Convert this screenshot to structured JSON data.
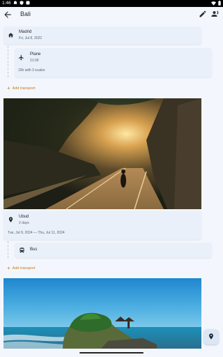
{
  "status_bar": {
    "time": "1:46",
    "icons": [
      "notification-icon",
      "shield-icon",
      "play-store-icon"
    ],
    "right_icons": [
      "wifi-icon",
      "battery-icon"
    ]
  },
  "app_bar": {
    "title": "Bali",
    "icons": [
      "back-arrow-icon",
      "edit-icon",
      "people-icon"
    ]
  },
  "itinerary": {
    "start": {
      "place": "Madrid",
      "date": "Fri, Jul 8, 2022"
    },
    "transport1": {
      "mode": "Plane",
      "time": "21:00",
      "note": "19h with 3 scales"
    },
    "add_transport_label": "Add transport",
    "stop1": {
      "place": "Ubud",
      "duration": "2 days",
      "dates": "Tue, Jul 9, 2024 — Thu, Jul 11, 2024"
    },
    "transport2": {
      "mode": "Bus"
    },
    "add_transport_label_2": "Add transport"
  }
}
